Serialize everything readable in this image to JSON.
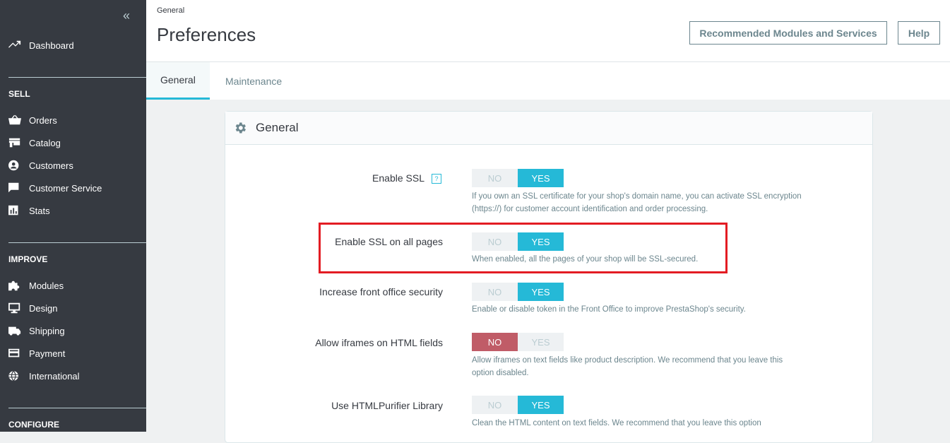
{
  "sidebar": {
    "collapse_icon": "«",
    "dashboard": "Dashboard",
    "sections": {
      "sell": "SELL",
      "improve": "IMPROVE",
      "configure": "CONFIGURE"
    },
    "sell_items": [
      "Orders",
      "Catalog",
      "Customers",
      "Customer Service",
      "Stats"
    ],
    "improve_items": [
      "Modules",
      "Design",
      "Shipping",
      "Payment",
      "International"
    ]
  },
  "header": {
    "breadcrumb": "General",
    "title": "Preferences",
    "btn_recommended": "Recommended Modules and Services",
    "btn_help": "Help"
  },
  "tabs": [
    "General",
    "Maintenance"
  ],
  "panel": {
    "title": "General",
    "rows": [
      {
        "label": "Enable SSL",
        "no": "NO",
        "yes": "YES",
        "selected": "yes",
        "help_icon": "?",
        "desc": "If you own an SSL certificate for your shop's domain name, you can activate SSL encryption (https://) for customer account identification and order processing."
      },
      {
        "label": "Enable SSL on all pages",
        "no": "NO",
        "yes": "YES",
        "selected": "yes",
        "desc": "When enabled, all the pages of your shop will be SSL-secured."
      },
      {
        "label": "Increase front office security",
        "no": "NO",
        "yes": "YES",
        "selected": "yes",
        "desc": "Enable or disable token in the Front Office to improve PrestaShop's security."
      },
      {
        "label": "Allow iframes on HTML fields",
        "no": "NO",
        "yes": "YES",
        "selected": "no",
        "desc": "Allow iframes on text fields like product description. We recommend that you leave this option disabled."
      },
      {
        "label": "Use HTMLPurifier Library",
        "no": "NO",
        "yes": "YES",
        "selected": "yes",
        "desc": "Clean the HTML content on text fields. We recommend that you leave this option"
      }
    ]
  },
  "colors": {
    "sidebar_bg": "#363a41",
    "accent": "#25b9d7",
    "danger": "#c05c67",
    "highlight": "#e31c23"
  }
}
